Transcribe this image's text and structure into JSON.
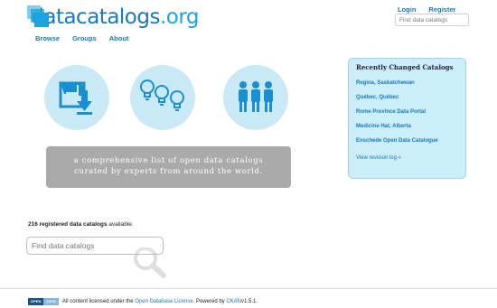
{
  "logo": {
    "text_main": "datacatalogs",
    "text_tld": ".org"
  },
  "header": {
    "login": "Login",
    "register": "Register",
    "search_placeholder": "Find data catalogs"
  },
  "nav": {
    "items": [
      "Browse",
      "Groups",
      "About"
    ]
  },
  "hero": {
    "icons": [
      "save-download-icon",
      "lightbulbs-icon",
      "people-icon"
    ],
    "tagline_line1": "a comprehensive list of open data catalogs",
    "tagline_line2": "curated by experts from around the world."
  },
  "sidebar": {
    "title": "Recently Changed Catalogs",
    "items": [
      "Regina, Saskatchewan",
      "Québec, Québec",
      "Rome Province Data Portal",
      "Medicine Hat, Alberta",
      "Enschede Open Data Catalogue"
    ],
    "log_link": "View revision log »"
  },
  "main": {
    "count_number": "216 registered data catalogs",
    "count_suffix": " available.",
    "search_placeholder": "Find data catalogs"
  },
  "footer": {
    "badge_left": "OPEN",
    "badge_right": "DATA",
    "text_prefix": "All content licensed under the ",
    "license_link": "Open Database License",
    "text_mid": ". Powered by ",
    "ckan_link": "CKAN",
    "text_suffix": " v1.5.1."
  },
  "colors": {
    "brand": "#1ba4de",
    "link": "#1a79b8",
    "circle": "#c9e9f7",
    "sidebar_bg": "#cbeefa",
    "tagline_bg": "#aaaaaa"
  }
}
